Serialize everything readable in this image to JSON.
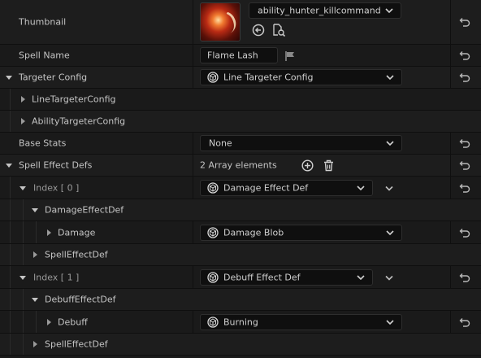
{
  "thumbnail": {
    "label": "Thumbnail",
    "asset": "ability_hunter_killcommand"
  },
  "spell_name": {
    "label": "Spell Name",
    "value": "Flame Lash"
  },
  "targeter_config": {
    "label": "Targeter Config",
    "value": "Line Targeter Config",
    "children": [
      "LineTargeterConfig",
      "AbilityTargeterConfig"
    ]
  },
  "base_stats": {
    "label": "Base Stats",
    "value": "None"
  },
  "spell_effect_defs": {
    "label": "Spell Effect Defs",
    "count_text": "2 Array elements",
    "elements": [
      {
        "index_label": "Index [ 0 ]",
        "value": "Damage Effect Def",
        "group": "DamageEffectDef",
        "field_label": "Damage",
        "field_value": "Damage Blob",
        "child": "SpellEffectDef"
      },
      {
        "index_label": "Index [ 1 ]",
        "value": "Debuff Effect Def",
        "group": "DebuffEffectDef",
        "field_label": "Debuff",
        "field_value": "Burning",
        "child": "SpellEffectDef"
      }
    ]
  },
  "colors": {
    "background": "#1a1a1a",
    "field": "#0f0f0f",
    "text": "#c4c4c4"
  }
}
